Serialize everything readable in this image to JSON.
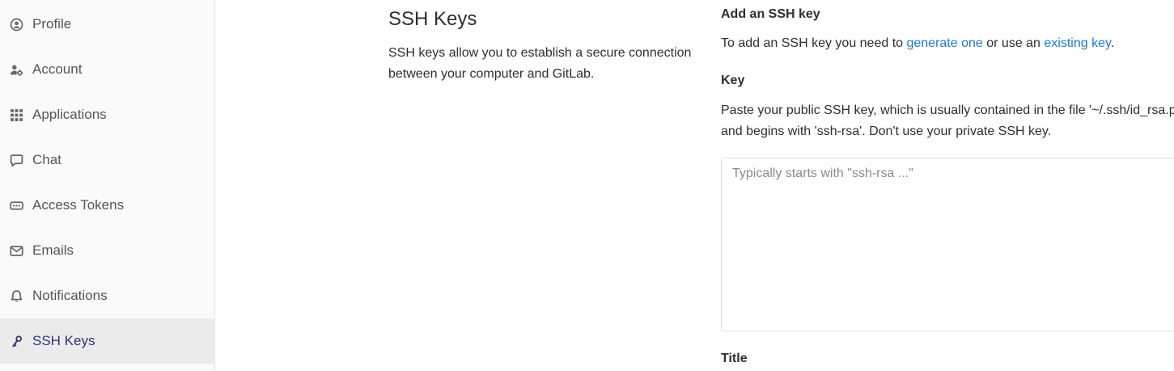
{
  "sidebar": {
    "items": [
      {
        "label": "Profile",
        "icon": "profile-icon",
        "active": false
      },
      {
        "label": "Account",
        "icon": "account-icon",
        "active": false
      },
      {
        "label": "Applications",
        "icon": "applications-icon",
        "active": false
      },
      {
        "label": "Chat",
        "icon": "chat-icon",
        "active": false
      },
      {
        "label": "Access Tokens",
        "icon": "access-tokens-icon",
        "active": false
      },
      {
        "label": "Emails",
        "icon": "emails-icon",
        "active": false
      },
      {
        "label": "Notifications",
        "icon": "notifications-icon",
        "active": false
      },
      {
        "label": "SSH Keys",
        "icon": "ssh-key-icon",
        "active": true
      }
    ]
  },
  "section": {
    "title": "SSH Keys",
    "description": "SSH keys allow you to establish a secure connection between your computer and GitLab."
  },
  "add_key": {
    "heading": "Add an SSH key",
    "text_prefix": "To add an SSH key you need to ",
    "generate_link": "generate one",
    "text_middle": " or use an ",
    "existing_link": "existing key",
    "text_suffix": "."
  },
  "key_field": {
    "label": "Key",
    "help": "Paste your public SSH key, which is usually contained in the file '~/.ssh/id_rsa.pub' and begins with 'ssh-rsa'. Don't use your private SSH key.",
    "placeholder": "Typically starts with \"ssh-rsa ...\"",
    "value": ""
  },
  "title_field": {
    "label": "Title"
  },
  "colors": {
    "link": "#1f78d1",
    "active_nav_text": "#303079",
    "sidebar_bg": "#fafafa",
    "active_nav_bg": "#ebebeb"
  }
}
